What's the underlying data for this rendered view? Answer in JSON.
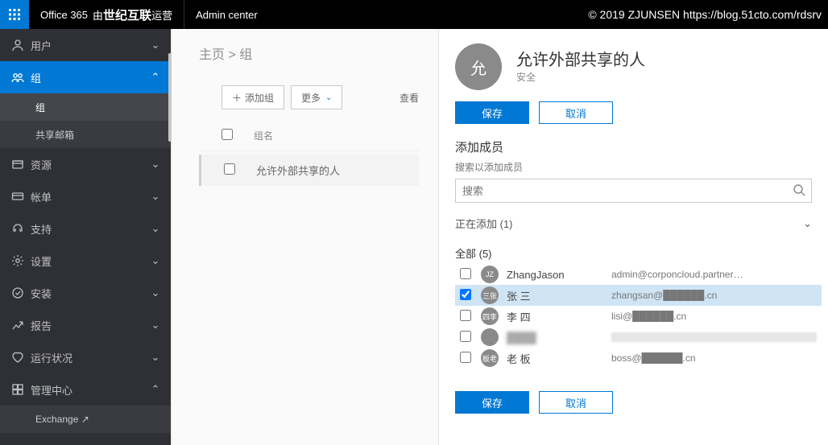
{
  "topbar": {
    "product": "Office 365",
    "operator_prefix": "由",
    "operator_bold": "世纪互联",
    "operator_suffix": "运营",
    "admin_center": "Admin center",
    "copyright": "© 2019 ZJUNSEN https://blog.51cto.com/rdsrv"
  },
  "nav": {
    "items": [
      {
        "id": "users",
        "label": "用户",
        "expanded": false
      },
      {
        "id": "groups",
        "label": "组",
        "expanded": true,
        "active": true,
        "children": [
          {
            "id": "groups-groups",
            "label": "组",
            "active": true
          },
          {
            "id": "shared-mailboxes",
            "label": "共享邮箱"
          }
        ]
      },
      {
        "id": "resources",
        "label": "资源",
        "expanded": false
      },
      {
        "id": "billing",
        "label": "帐单",
        "expanded": false
      },
      {
        "id": "support",
        "label": "支持",
        "expanded": false
      },
      {
        "id": "settings",
        "label": "设置",
        "expanded": false
      },
      {
        "id": "setup",
        "label": "安装",
        "expanded": false
      },
      {
        "id": "reports",
        "label": "报告",
        "expanded": false
      },
      {
        "id": "health",
        "label": "运行状况",
        "expanded": false
      },
      {
        "id": "admincenters",
        "label": "管理中心",
        "expanded": true,
        "children": [
          {
            "id": "admin-exchange",
            "label": "Exchange ↗"
          }
        ]
      }
    ]
  },
  "main": {
    "breadcrumb": "主页 > 组",
    "add_group": "添加组",
    "more": "更多",
    "view": "查看",
    "col_groupname": "组名",
    "rows": [
      {
        "name": "允许外部共享的人"
      }
    ]
  },
  "flyout": {
    "avatar_text": "允",
    "title": "允许外部共享的人",
    "subtitle": "安全",
    "save": "保存",
    "cancel": "取消",
    "section_add_members": "添加成员",
    "search_hint": "搜索以添加成员",
    "search_placeholder": "搜索",
    "adding_label": "正在添加 (1)",
    "all_label": "全部 (5)",
    "members": [
      {
        "avatar": "JZ",
        "name": "ZhangJason",
        "email": "admin@corponcloud.partner…",
        "checked": false
      },
      {
        "avatar": "三张",
        "name": "张 三",
        "email": "zhangsan@██████.cn",
        "checked": true
      },
      {
        "avatar": "四李",
        "name": "李 四",
        "email": "lisi@██████.cn",
        "checked": false
      },
      {
        "avatar": "",
        "name": "",
        "email": "",
        "checked": false,
        "redacted": true
      },
      {
        "avatar": "板老",
        "name": "老 板",
        "email": "boss@██████.cn",
        "checked": false
      }
    ]
  },
  "colors": {
    "accent": "#0078d4"
  }
}
